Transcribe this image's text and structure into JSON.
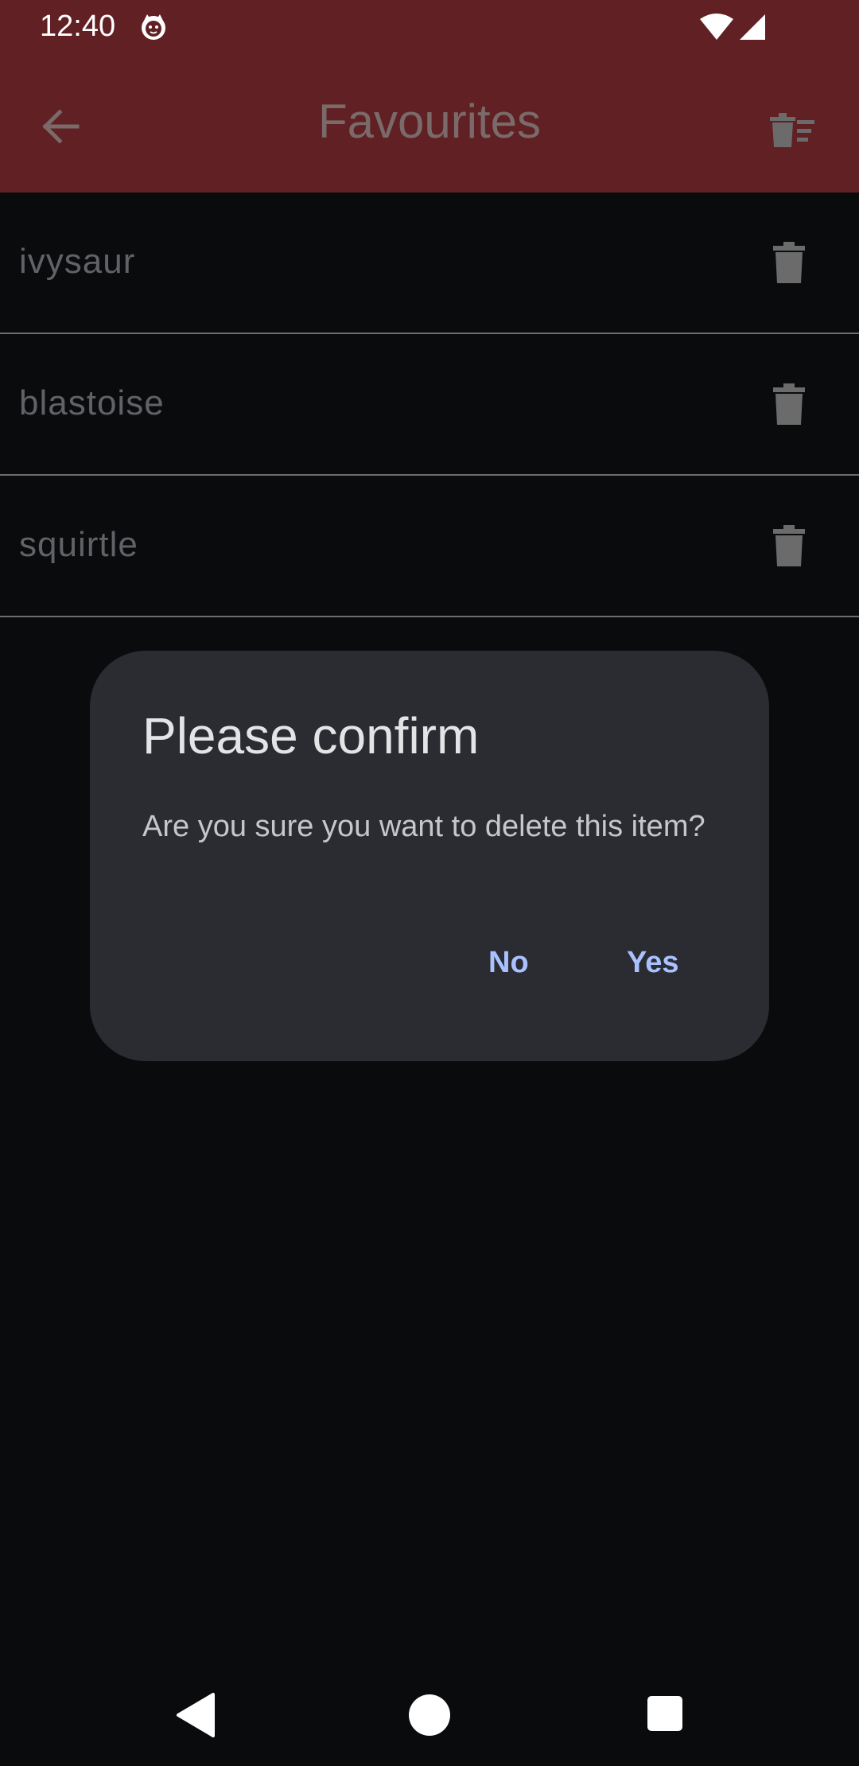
{
  "status_bar": {
    "time": "12:40",
    "app_icon": "cat-notification-icon",
    "wifi_icon": "wifi-icon",
    "signal_icon": "cell-signal-icon"
  },
  "app_bar": {
    "title": "Favourites",
    "back_icon": "arrow-back-icon",
    "delete_all_icon": "delete-sweep-icon",
    "background_color": "#612124"
  },
  "favourites": {
    "items": [
      {
        "name": "ivysaur",
        "delete_icon": "trash-icon"
      },
      {
        "name": "blastoise",
        "delete_icon": "trash-icon"
      },
      {
        "name": "squirtle",
        "delete_icon": "trash-icon"
      }
    ]
  },
  "dialog": {
    "title": "Please confirm",
    "message": "Are you sure you want to delete this item?",
    "no_label": "No",
    "yes_label": "Yes",
    "button_color": "#a9c2ff"
  },
  "nav_bar": {
    "back_icon": "nav-back-triangle-icon",
    "home_icon": "nav-home-circle-icon",
    "recents_icon": "nav-recents-square-icon"
  }
}
